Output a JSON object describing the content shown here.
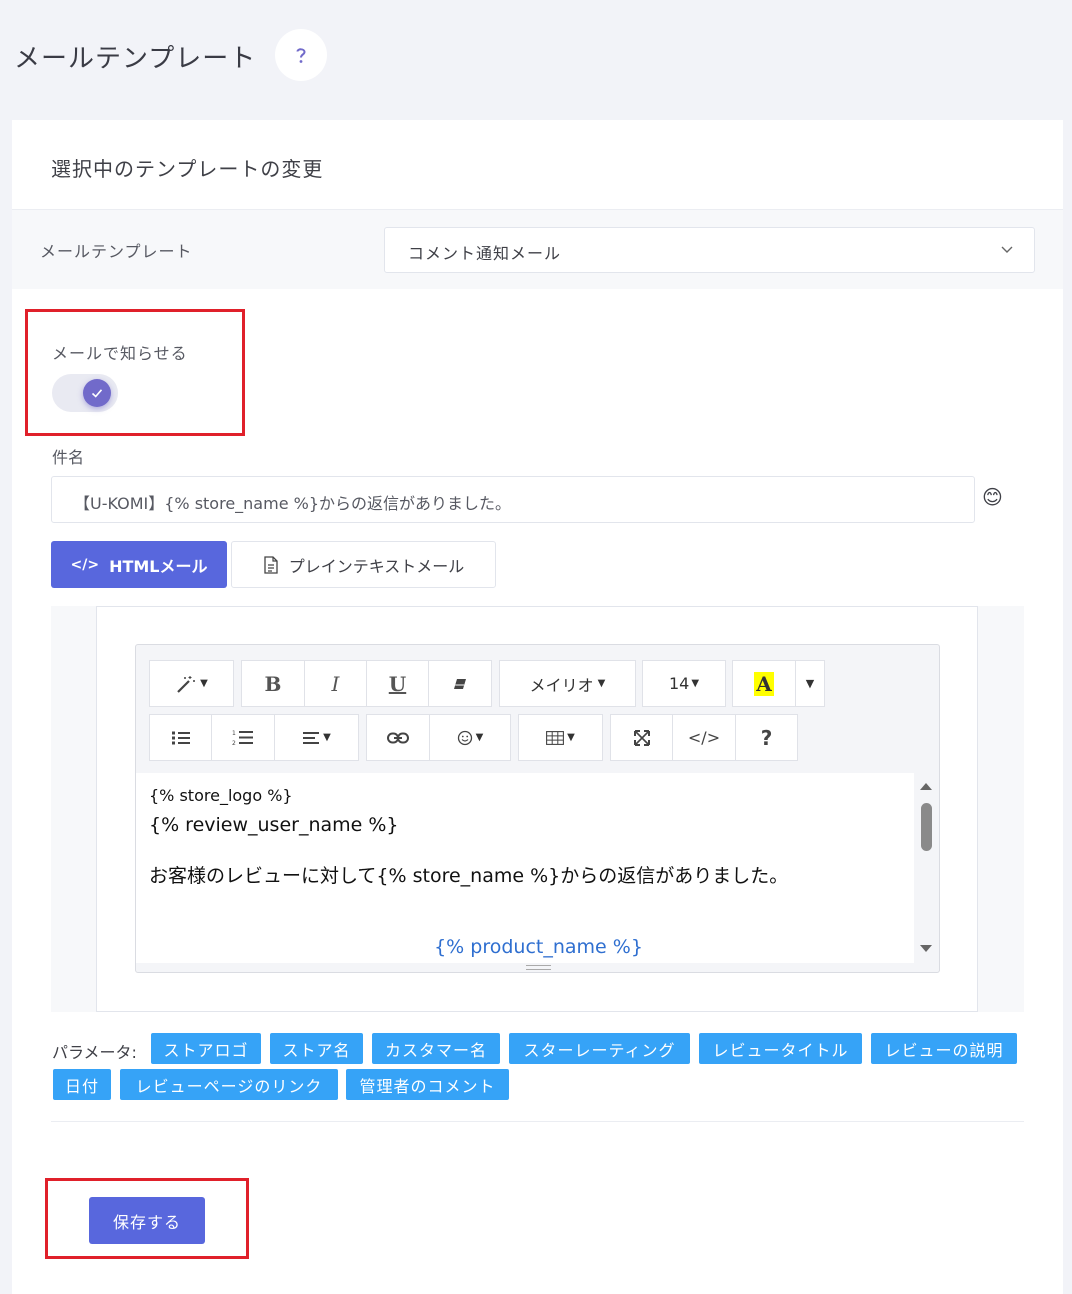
{
  "page": {
    "title": "メールテンプレート"
  },
  "card": {
    "title": "選択中のテンプレートの変更"
  },
  "template": {
    "label": "メールテンプレート",
    "selected": "コメント通知メール"
  },
  "notify": {
    "label": "メールで知らせる",
    "enabled": true
  },
  "subject": {
    "label": "件名",
    "value": "【U-KOMI】{% store_name %}からの返信がありました。"
  },
  "tabs": {
    "html": "HTMLメール",
    "plain": "プレインテキストメール"
  },
  "toolbar": {
    "bold": "B",
    "italic": "I",
    "underline": "U",
    "font_name": "メイリオ",
    "font_size": "14",
    "color_letter": "A",
    "help": "?",
    "code": "</>"
  },
  "editor": {
    "line1": "{% store_logo %}",
    "line2": "{% review_user_name %}",
    "line3": "お客様のレビューに対して{% store_name %}からの返信がありました。",
    "line4": "{% product_name %}"
  },
  "params": {
    "label": "パラメータ:",
    "chips": [
      "ストアロゴ",
      "ストア名",
      "カスタマー名",
      "スターレーティング",
      "レビュータイトル",
      "レビューの説明",
      "日付",
      "レビューページのリンク",
      "管理者のコメント"
    ]
  },
  "save": {
    "label": "保存する"
  },
  "colors": {
    "primary": "#5867dd",
    "chip": "#36a3f7",
    "toggle": "#716aca",
    "highlight": "#e0202a"
  }
}
